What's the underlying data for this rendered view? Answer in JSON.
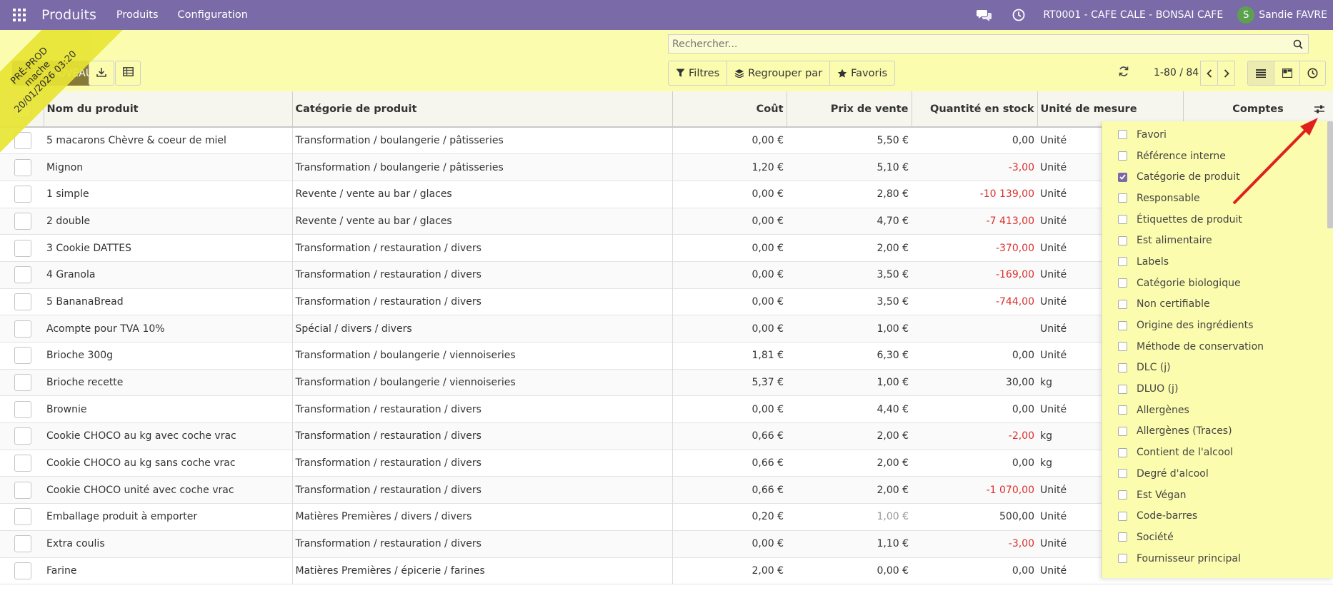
{
  "navbar": {
    "brand": "Produits",
    "menu": [
      "Produits",
      "Configuration"
    ],
    "company": "RT0001 - CAFE CALE - BONSAI CAFE",
    "user_initial": "S",
    "user_name": "Sandie FAVRE"
  },
  "control": {
    "search_placeholder": "Rechercher...",
    "new_label": "+ NOUVEAU",
    "filters_label": "Filtres",
    "groupby_label": "Regrouper par",
    "favorites_label": "Favoris",
    "pager": "1-80 / 84"
  },
  "ribbon": {
    "line1": "PRÉ-PROD",
    "line2": "mache",
    "line3": "20/01/2026 03:20"
  },
  "table": {
    "headers": {
      "name": "Nom du produit",
      "category": "Catégorie de produit",
      "cost": "Coût",
      "price": "Prix de vente",
      "qty": "Quantité en stock",
      "uom": "Unité de mesure",
      "accounts": "Comptes"
    },
    "rows": [
      {
        "name": "5 macarons Chèvre & coeur de miel",
        "category": "Transformation / boulangerie / pâtisseries",
        "cost": "0,00 €",
        "price": "5,50 €",
        "qty": "0,00",
        "uom": "Unité",
        "qty_neg": false
      },
      {
        "name": "Mignon",
        "category": "Transformation / boulangerie / pâtisseries",
        "cost": "1,20 €",
        "price": "5,10 €",
        "qty": "-3,00",
        "uom": "Unité",
        "qty_neg": true
      },
      {
        "name": "1 simple",
        "category": "Revente / vente au bar / glaces",
        "cost": "0,00 €",
        "price": "2,80 €",
        "qty": "-10 139,00",
        "uom": "Unité",
        "qty_neg": true
      },
      {
        "name": "2 double",
        "category": "Revente / vente au bar / glaces",
        "cost": "0,00 €",
        "price": "4,70 €",
        "qty": "-7 413,00",
        "uom": "Unité",
        "qty_neg": true
      },
      {
        "name": "3 Cookie DATTES",
        "category": "Transformation / restauration / divers",
        "cost": "0,00 €",
        "price": "2,00 €",
        "qty": "-370,00",
        "uom": "Unité",
        "qty_neg": true
      },
      {
        "name": "4 Granola",
        "category": "Transformation / restauration / divers",
        "cost": "0,00 €",
        "price": "3,50 €",
        "qty": "-169,00",
        "uom": "Unité",
        "qty_neg": true
      },
      {
        "name": "5 BananaBread",
        "category": "Transformation / restauration / divers",
        "cost": "0,00 €",
        "price": "3,50 €",
        "qty": "-744,00",
        "uom": "Unité",
        "qty_neg": true
      },
      {
        "name": "Acompte pour TVA 10%",
        "category": "Spécial / divers / divers",
        "cost": "0,00 €",
        "price": "1,00 €",
        "qty": "",
        "uom": "Unité",
        "qty_neg": false
      },
      {
        "name": "Brioche 300g",
        "category": "Transformation / boulangerie / viennoiseries",
        "cost": "1,81 €",
        "price": "6,30 €",
        "qty": "0,00",
        "uom": "Unité",
        "qty_neg": false
      },
      {
        "name": "Brioche recette",
        "category": "Transformation / boulangerie / viennoiseries",
        "cost": "5,37 €",
        "price": "1,00 €",
        "qty": "30,00",
        "uom": "kg",
        "qty_neg": false
      },
      {
        "name": "Brownie",
        "category": "Transformation / restauration / divers",
        "cost": "0,00 €",
        "price": "4,40 €",
        "qty": "0,00",
        "uom": "Unité",
        "qty_neg": false
      },
      {
        "name": "Cookie CHOCO au kg avec coche vrac",
        "category": "Transformation / restauration / divers",
        "cost": "0,66 €",
        "price": "2,00 €",
        "qty": "-2,00",
        "uom": "kg",
        "qty_neg": true
      },
      {
        "name": "Cookie CHOCO au kg sans coche vrac",
        "category": "Transformation / restauration / divers",
        "cost": "0,66 €",
        "price": "2,00 €",
        "qty": "0,00",
        "uom": "kg",
        "qty_neg": false
      },
      {
        "name": "Cookie CHOCO unité avec coche vrac",
        "category": "Transformation / restauration / divers",
        "cost": "0,66 €",
        "price": "2,00 €",
        "qty": "-1 070,00",
        "uom": "Unité",
        "qty_neg": true
      },
      {
        "name": "Emballage produit à emporter",
        "category": "Matières Premières / divers / divers",
        "cost": "0,20 €",
        "price": "1,00 €",
        "qty": "500,00",
        "uom": "Unité",
        "qty_neg": false,
        "price_muted": true
      },
      {
        "name": "Extra coulis",
        "category": "Transformation / restauration / divers",
        "cost": "0,00 €",
        "price": "1,10 €",
        "qty": "-3,00",
        "uom": "Unité",
        "qty_neg": true
      },
      {
        "name": "Farine",
        "category": "Matières Premières / épicerie / farines",
        "cost": "2,00 €",
        "price": "0,00 €",
        "qty": "0,00",
        "uom": "Unité",
        "qty_neg": false
      }
    ]
  },
  "optional_columns": [
    {
      "label": "Favori",
      "checked": false
    },
    {
      "label": "Référence interne",
      "checked": false
    },
    {
      "label": "Catégorie de produit",
      "checked": true
    },
    {
      "label": "Responsable",
      "checked": false
    },
    {
      "label": "Étiquettes de produit",
      "checked": false
    },
    {
      "label": "Est alimentaire",
      "checked": false
    },
    {
      "label": "Labels",
      "checked": false
    },
    {
      "label": "Catégorie biologique",
      "checked": false
    },
    {
      "label": "Non certifiable",
      "checked": false
    },
    {
      "label": "Origine des ingrédients",
      "checked": false
    },
    {
      "label": "Méthode de conservation",
      "checked": false
    },
    {
      "label": "DLC (j)",
      "checked": false
    },
    {
      "label": "DLUO (j)",
      "checked": false
    },
    {
      "label": "Allergènes",
      "checked": false
    },
    {
      "label": "Allergènes (Traces)",
      "checked": false
    },
    {
      "label": "Contient de l'alcool",
      "checked": false
    },
    {
      "label": "Degré d'alcool",
      "checked": false
    },
    {
      "label": "Est Végan",
      "checked": false
    },
    {
      "label": "Code-barres",
      "checked": false
    },
    {
      "label": "Société",
      "checked": false
    },
    {
      "label": "Fournisseur principal",
      "checked": false
    }
  ],
  "colors": {
    "navbar": "#7a6aa8",
    "panel": "#fbfcae",
    "negative": "#d9302c",
    "new_button": "#877a38"
  }
}
